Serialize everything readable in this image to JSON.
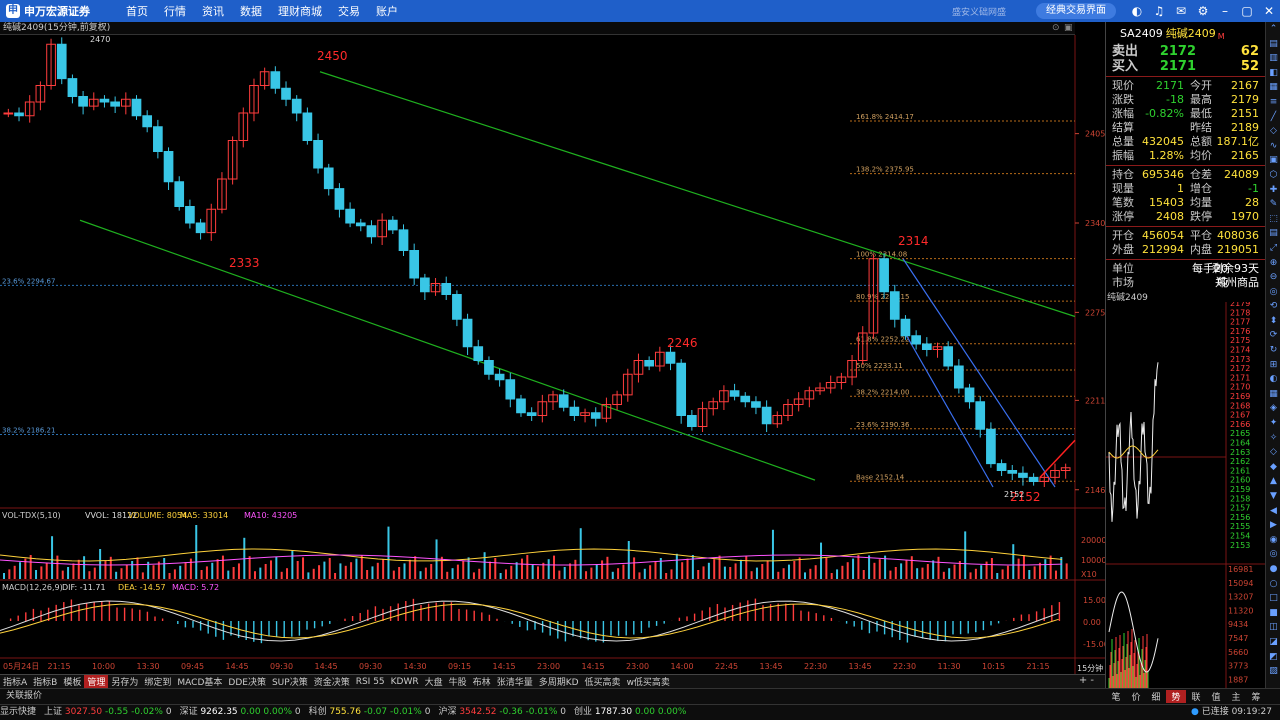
{
  "topbar": {
    "logo": "申万宏源证券",
    "nav": [
      "首页",
      "行情",
      "资讯",
      "数据",
      "理财商城",
      "交易",
      "账户"
    ],
    "ghost": "盛安义础网盛",
    "classic": "经典交易界面"
  },
  "tab": {
    "title": "纯碱2409(15分钟,前复权)"
  },
  "chart_data": {
    "type": "candlestick",
    "symbol": "纯碱2409",
    "period": "15分钟",
    "price_labels": [
      "2405",
      "2340",
      "2275",
      "2211",
      "2146"
    ],
    "annotations": {
      "high_tick": "2470",
      "peak1": "2450",
      "trough1": "2333",
      "mid": "2246",
      "peak2": "2314",
      "low": "2152",
      "low2": "2152"
    },
    "fib_levels": [
      {
        "label": "161.8% 2414.17",
        "v": 2414.17
      },
      {
        "label": "138.2% 2375.95",
        "v": 2375.95
      },
      {
        "label": "100% 2314.08",
        "v": 2314.08
      },
      {
        "label": "80.9% 2283.15",
        "v": 2283.15
      },
      {
        "label": "61.8% 2252.22",
        "v": 2252.22
      },
      {
        "label": "50% 2233.11",
        "v": 2233.11
      },
      {
        "label": "38.2% 2214.00",
        "v": 2214.0
      },
      {
        "label": "23.6% 2190.36",
        "v": 2190.36
      },
      {
        "label": "Base 2152.14",
        "v": 2152.14
      }
    ],
    "left_levels": [
      {
        "label": "23.6% 2294.67",
        "v": 2294.67
      },
      {
        "label": "38.2% 2186.21",
        "v": 2186.21
      }
    ],
    "closes": [
      2420,
      2418,
      2428,
      2440,
      2470,
      2445,
      2432,
      2425,
      2430,
      2428,
      2425,
      2430,
      2418,
      2410,
      2392,
      2370,
      2352,
      2340,
      2333,
      2350,
      2372,
      2400,
      2420,
      2440,
      2450,
      2438,
      2430,
      2420,
      2400,
      2380,
      2365,
      2350,
      2340,
      2338,
      2330,
      2342,
      2335,
      2320,
      2300,
      2290,
      2296,
      2288,
      2270,
      2250,
      2240,
      2230,
      2226,
      2212,
      2202,
      2200,
      2210,
      2215,
      2206,
      2200,
      2202,
      2198,
      2208,
      2215,
      2230,
      2240,
      2236,
      2246,
      2238,
      2200,
      2192,
      2205,
      2210,
      2218,
      2214,
      2210,
      2206,
      2194,
      2200,
      2208,
      2212,
      2218,
      2220,
      2224,
      2228,
      2240,
      2260,
      2314,
      2290,
      2270,
      2258,
      2252,
      2248,
      2250,
      2236,
      2220,
      2210,
      2190,
      2165,
      2160,
      2158,
      2155,
      2152,
      2155,
      2160,
      2162
    ],
    "vol_indicator": {
      "name": "VOL-TDX(5,10)",
      "vvol": "VVOL: 18122",
      "volume": "VOLUME: 8054",
      "ma5": "MA5: 33014",
      "ma10": "MA10: 43205",
      "axis": [
        "20000",
        "10000",
        "X10"
      ]
    },
    "macd": {
      "name": "MACD(12,26,9)",
      "dif": "DIF: -11.71",
      "dea": "DEA: -14.57",
      "macd": "MACD: 5.72",
      "axis": [
        "15.00",
        "0.00",
        "-15.00"
      ]
    },
    "x_labels": [
      "05月24日",
      "21:15",
      "10:00",
      "13:30",
      "09:45",
      "14:45",
      "09:30",
      "14:45",
      "09:30",
      "14:30",
      "09:15",
      "14:15",
      "23:00",
      "14:15",
      "23:00",
      "14:00",
      "22:45",
      "13:45",
      "22:30",
      "13:45",
      "22:30",
      "11:30",
      "10:15",
      "21:15"
    ],
    "x_right": "15分钟"
  },
  "bottom_tabs": [
    "指标A",
    "指标B",
    "模板",
    "管理",
    "另存为",
    "绑定到",
    "MACD基本",
    "DDE决策",
    "SUP决策",
    "资金决策",
    "RSI 55",
    "KDWR",
    "大盘",
    "牛股",
    "布林",
    "张清华量",
    "多周期KD",
    "低买高卖",
    "w低买高卖"
  ],
  "bottom_tab_active": 3,
  "status1": {
    "label": "关联报价"
  },
  "right_tabs": [
    "笔",
    "价",
    "细",
    "势",
    "联",
    "值",
    "主",
    "筹"
  ],
  "right_tab_active": 3,
  "status2": [
    {
      "name": "显示快捷",
      "v": ""
    },
    {
      "name": "上证",
      "v": "3027.50",
      "c": "-0.55",
      "p": "-0.02%",
      "x": "0"
    },
    {
      "name": "深证",
      "v": "9262.35",
      "c": "0.00",
      "p": "0.00%",
      "x": "0"
    },
    {
      "name": "科创",
      "v": "755.76",
      "c": "-0.07",
      "p": "-0.01%",
      "x": "0"
    },
    {
      "name": "沪深",
      "v": "3542.52",
      "c": "-0.36",
      "p": "-0.01%",
      "x": "0"
    },
    {
      "name": "创业",
      "v": "1787.30",
      "c": "0.00",
      "p": "0.00%",
      "x": ""
    }
  ],
  "status2_tail": {
    "conn": "已连接",
    "time": "09:19:27"
  },
  "quote": {
    "code": "SA2409",
    "name": "纯碱2409",
    "sub": "M",
    "sell_label": "卖出",
    "sell_price": "2172",
    "sell_vol": "62",
    "buy_label": "买入",
    "buy_price": "2171",
    "buy_vol": "52",
    "rows1": [
      [
        "现价",
        "2171",
        "今开",
        "2167"
      ],
      [
        "涨跌",
        "-18",
        "最高",
        "2179"
      ],
      [
        "涨幅",
        "-0.82%",
        "最低",
        "2151"
      ],
      [
        "结算",
        "",
        "昨结",
        "2189"
      ],
      [
        "总量",
        "432045",
        "总额",
        "187.1亿"
      ],
      [
        "振幅",
        "1.28%",
        "均价",
        "2165"
      ]
    ],
    "rows2": [
      [
        "持仓",
        "695346",
        "仓差",
        "24089"
      ],
      [
        "现量",
        "1",
        "增仓",
        "-1"
      ],
      [
        "笔数",
        "15403",
        "均量",
        "28"
      ],
      [
        "涨停",
        "2408",
        "跌停",
        "1970"
      ]
    ],
    "rows3": [
      [
        "开仓",
        "456054",
        "平仓",
        "408036"
      ],
      [
        "外盘",
        "212994",
        "内盘",
        "219051"
      ]
    ],
    "rows4": [
      [
        "单位",
        "每手20吨",
        "剩余93天"
      ],
      [
        "市场",
        "",
        "郑州商品"
      ]
    ],
    "mini_title": "纯碱2409",
    "mini_prices": [
      "2179",
      "2178",
      "2177",
      "2176",
      "2175",
      "2174",
      "2173",
      "2172",
      "2171",
      "2170",
      "2169",
      "2168",
      "2167",
      "2166",
      "2165",
      "2164",
      "2163",
      "2162",
      "2161",
      "2160",
      "2159",
      "2158",
      "2157",
      "2156",
      "2155",
      "2154",
      "2153"
    ],
    "mini_vol": [
      "16981",
      "15094",
      "13207",
      "11320",
      "9434",
      "7547",
      "5660",
      "3773",
      "1887"
    ]
  }
}
